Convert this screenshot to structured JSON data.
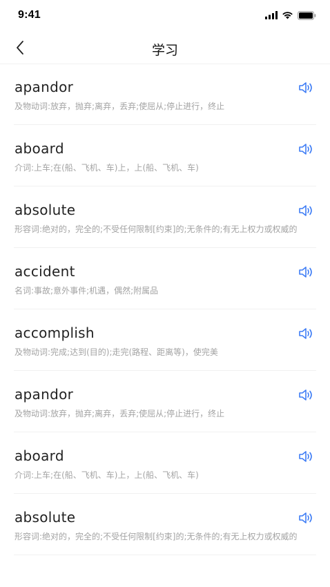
{
  "status_bar": {
    "time": "9:41"
  },
  "nav": {
    "back_icon": "chevron-left-icon",
    "title": "学习"
  },
  "colors": {
    "accent": "#3d7cf5",
    "definition": "#a3a3a3"
  },
  "words": [
    {
      "word": "apandor",
      "definition": "及物动词:放弃，抛弃;离弃，丢弃;使屈从;停止进行，终止"
    },
    {
      "word": "aboard",
      "definition": "介词:上车;在(船、飞机、车)上，上(船、飞机、车)"
    },
    {
      "word": "absolute",
      "definition": "形容词:绝对的，完全的;不受任何限制[约束]的;无条件的;有无上权力或权威的"
    },
    {
      "word": "accident",
      "definition": "名词:事故;意外事件;机遇，偶然;附属品"
    },
    {
      "word": "accomplish",
      "definition": "及物动词:完成;达到(目的);走完(路程、距离等)，使完美"
    },
    {
      "word": "apandor",
      "definition": "及物动词:放弃，抛弃;离弃，丢弃;使屈从;停止进行，终止"
    },
    {
      "word": "aboard",
      "definition": "介词:上车;在(船、飞机、车)上，上(船、飞机、车)"
    },
    {
      "word": "absolute",
      "definition": "形容词:绝对的，完全的;不受任何限制[约束]的;无条件的;有无上权力或权威的"
    }
  ]
}
